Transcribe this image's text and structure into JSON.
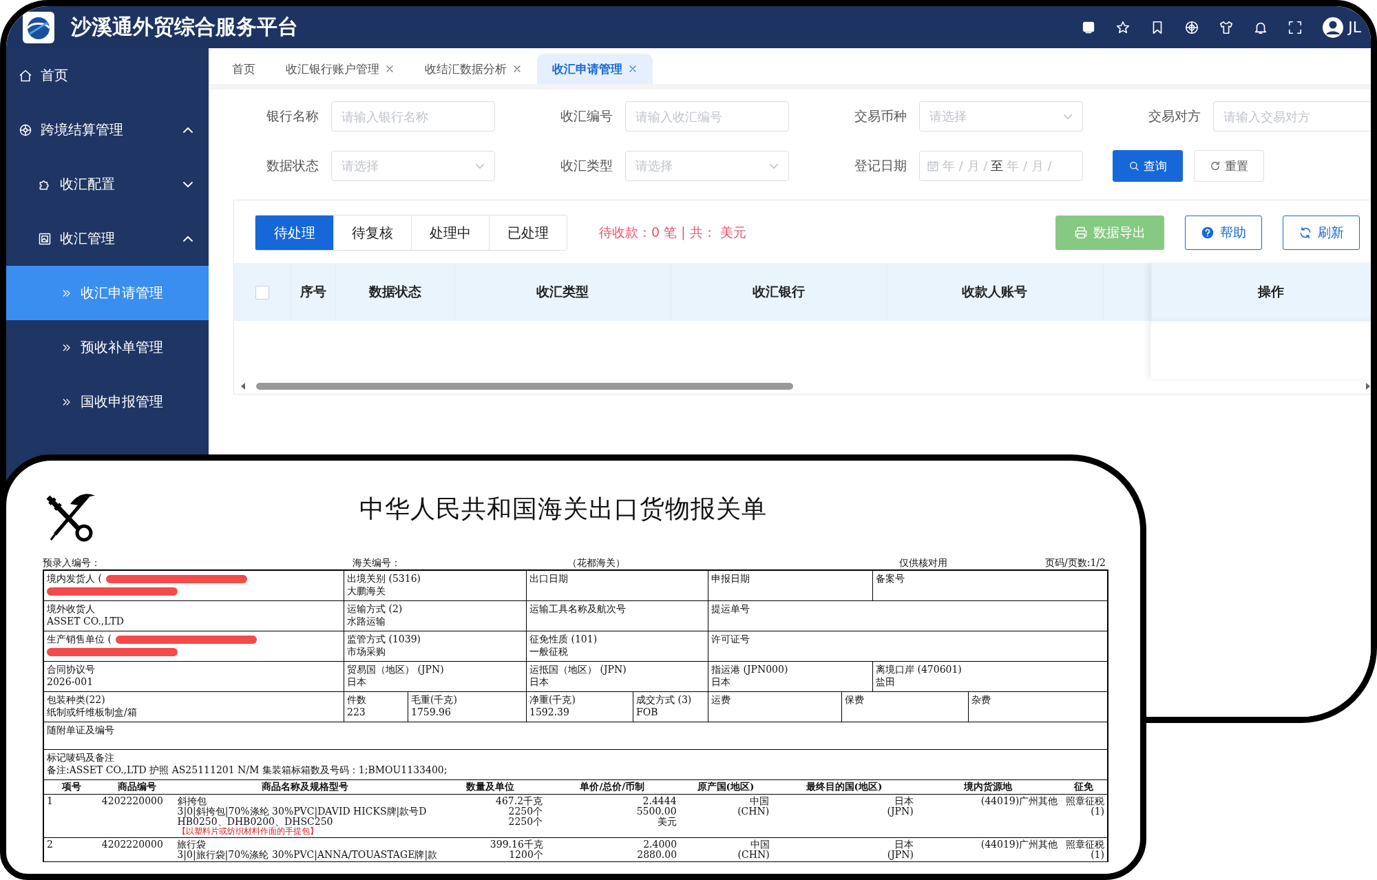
{
  "header": {
    "title": "沙溪通外贸综合服务平台",
    "user": "JL"
  },
  "sidebar": {
    "items": [
      {
        "label": "首页"
      },
      {
        "label": "跨境结算管理",
        "expanded": true,
        "children": [
          {
            "label": "收汇配置",
            "expanded": false
          },
          {
            "label": "收汇管理",
            "expanded": true,
            "children": [
              {
                "label": "收汇申请管理",
                "selected": true
              },
              {
                "label": "预收补单管理",
                "selected": false
              },
              {
                "label": "国收申报管理",
                "selected": false
              }
            ]
          }
        ]
      }
    ]
  },
  "tabs": [
    {
      "label": "首页",
      "closable": false,
      "selected": false
    },
    {
      "label": "收汇银行账户管理",
      "closable": true,
      "selected": false
    },
    {
      "label": "收结汇数据分析",
      "closable": true,
      "selected": false
    },
    {
      "label": "收汇申请管理",
      "closable": true,
      "selected": true
    }
  ],
  "filters": [
    {
      "label": "银行名称",
      "kind": "input",
      "placeholder": "请输入银行名称"
    },
    {
      "label": "收汇编号",
      "kind": "input",
      "placeholder": "请输入收汇编号"
    },
    {
      "label": "交易币种",
      "kind": "select",
      "placeholder": "请选择"
    },
    {
      "label": "交易对方",
      "kind": "input",
      "placeholder": "请输入交易对方"
    },
    {
      "label": "数据状态",
      "kind": "select",
      "placeholder": "请选择"
    },
    {
      "label": "收汇类型",
      "kind": "select",
      "placeholder": "请选择"
    },
    {
      "label": "登记日期",
      "kind": "daterange",
      "start_placeholder": "年 / 月 /",
      "separator": "至",
      "end_placeholder": "年 / 月 /"
    }
  ],
  "filter_buttons": [
    {
      "label": "查询",
      "kind": "search"
    },
    {
      "label": "重置",
      "kind": "reset"
    }
  ],
  "status_tabs": [
    {
      "label": "待处理",
      "selected": true
    },
    {
      "label": "待复核",
      "selected": false
    },
    {
      "label": "处理中",
      "selected": false
    },
    {
      "label": "已处理",
      "selected": false
    }
  ],
  "summary": "待收款：0 笔 | 共： 美元",
  "actions": [
    {
      "label": "数据导出",
      "kind": "export"
    },
    {
      "label": "帮助",
      "kind": "help"
    },
    {
      "label": "刷新",
      "kind": "refresh"
    }
  ],
  "table": {
    "select_all": false,
    "columns": [
      "序号",
      "数据状态",
      "收汇类型",
      "收汇银行",
      "收款人账号",
      "操作"
    ]
  },
  "declaration": {
    "title": "中华人民共和国海关出口货物报关单",
    "meta": [
      "预录入编号：",
      "海关编号：",
      "（花都海关）",
      "仅供核对用",
      "页码/页数:1/2"
    ],
    "rows": [
      [
        {
          "label": "境内发货人 (",
          "redacted": true
        },
        {
          "label": "出境关别 (5316)",
          "value": "大鹏海关"
        },
        {
          "label": "出口日期"
        },
        {
          "label": "申报日期"
        },
        {
          "label": "备案号"
        }
      ],
      [
        {
          "label": "境外收货人",
          "value": "ASSET CO.,LTD"
        },
        {
          "label": "运输方式 (2)",
          "value": "水路运输"
        },
        {
          "label": "运输工具名称及航次号"
        },
        {
          "label": "提运单号"
        }
      ],
      [
        {
          "label": "生产销售单位 (",
          "redacted": true
        },
        {
          "label": "监管方式 (1039)",
          "value": "市场采购"
        },
        {
          "label": "征免性质 (101)",
          "value": "一般征税"
        },
        {
          "label": "许可证号"
        }
      ],
      [
        {
          "label": "合同协议号",
          "value": "2026-001"
        },
        {
          "label": "贸易国（地区） (JPN)",
          "value": "日本"
        },
        {
          "label": "运抵国（地区） (JPN)",
          "value": "日本"
        },
        {
          "label": "指运港 (JPN000)",
          "value": "日本"
        },
        {
          "label": "离境口岸 (470601)",
          "value": "盐田"
        }
      ]
    ],
    "cargo": [
      {
        "label": "包装种类(22)",
        "value": "纸制或纤维板制盒/箱"
      },
      {
        "label": "件数",
        "value": "223"
      },
      {
        "label": "毛重(千克)",
        "value": "1759.96"
      },
      {
        "label": "净重(千克)",
        "value": "1592.39"
      },
      {
        "label": "成交方式 (3)",
        "value": "FOB"
      },
      {
        "label": "运费"
      },
      {
        "label": "保费"
      },
      {
        "label": "杂费"
      }
    ],
    "attachments": {
      "label": "随附单证及编号"
    },
    "marks": {
      "label": "标记唛码及备注",
      "value": "备注:ASSET CO.,LTD 护照 AS25111201 N/M 集装箱标箱数及号码：1;BMOU1133400;"
    },
    "goods_columns": [
      "项号",
      "商品编号",
      "商品名称及规格型号",
      "数量及单位",
      "单价/总价/币制",
      "原产国(地区)",
      "最终目的国(地区)",
      "境内货源地",
      "征免"
    ],
    "goods": [
      {
        "no": "1",
        "code": "4202220000",
        "name": [
          "斜挎包",
          "3|0|斜挎包|70%涤纶 30%PVC|DAVID HICKS牌|款号D",
          "HB0250、DHB0200、DHSC250"
        ],
        "note": "【以塑料片或纺织材料作面的手提包】",
        "quantity": [
          "467.2千克",
          "2250个",
          "2250个"
        ],
        "price": [
          "2.4444",
          "5500.00",
          "美元"
        ],
        "origin": [
          "中国",
          "(CHN)"
        ],
        "destination": [
          "日本",
          "(JPN)"
        ],
        "source": [
          "(44019)广州其他"
        ],
        "exemption": [
          "照章征税",
          "(1)"
        ]
      },
      {
        "no": "2",
        "code": "4202220000",
        "name": [
          "旅行袋",
          "3|0|旅行袋|70%涤纶 30%PVC|ANNA/TOUASTAGE牌|款"
        ],
        "quantity": [
          "399.16千克",
          "1200个"
        ],
        "price": [
          "2.4000",
          "2880.00"
        ],
        "origin": [
          "中国",
          "(CHN)"
        ],
        "destination": [
          "日本",
          "(JPN)"
        ],
        "source": [
          "(44019)广州其他"
        ],
        "exemption": [
          "照章征税",
          "(1)"
        ]
      }
    ]
  }
}
